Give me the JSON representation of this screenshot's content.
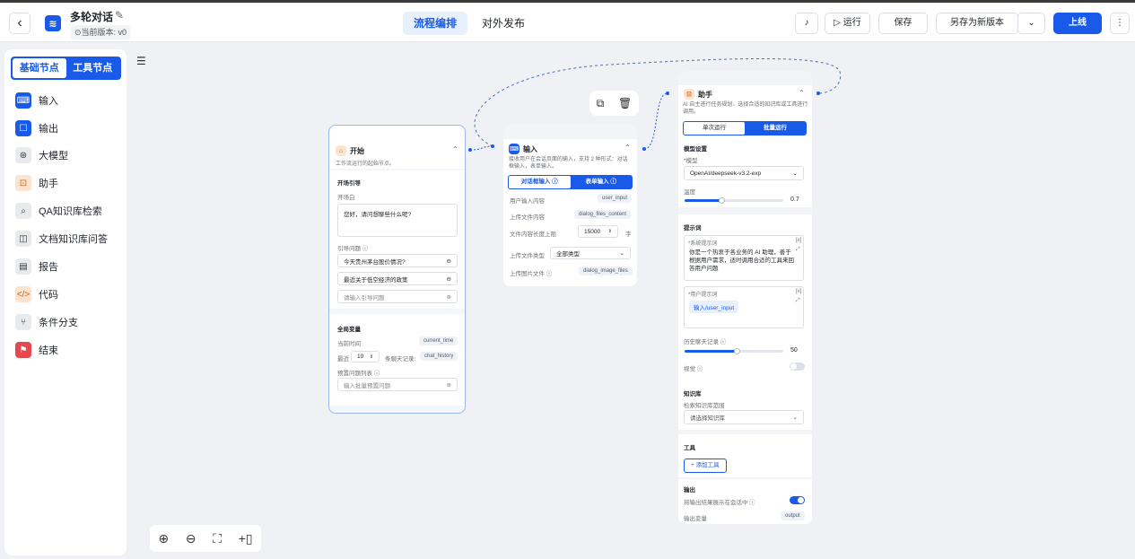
{
  "header": {
    "title": "多轮对话",
    "version": "当前版本: v0",
    "tabs": [
      {
        "label": "流程编排"
      },
      {
        "label": "对外发布"
      }
    ],
    "run_label": "运行",
    "save_label": "保存",
    "save_as_label": "另存为新版本",
    "publish_label": "上线"
  },
  "sidebar": {
    "tab_basic": "基础节点",
    "tab_tools": "工具节点",
    "items": [
      {
        "label": "输入",
        "icon": "keyboard-icon"
      },
      {
        "label": "输出",
        "icon": "chat-icon"
      },
      {
        "label": "大模型",
        "icon": "brain-icon"
      },
      {
        "label": "助手",
        "icon": "robot-icon"
      },
      {
        "label": "QA知识库检索",
        "icon": "search-doc-icon"
      },
      {
        "label": "文档知识库问答",
        "icon": "book-icon"
      },
      {
        "label": "报告",
        "icon": "report-icon"
      },
      {
        "label": "代码",
        "icon": "code-icon"
      },
      {
        "label": "条件分支",
        "icon": "branch-icon"
      },
      {
        "label": "结束",
        "icon": "flag-icon"
      }
    ]
  },
  "start_node": {
    "title": "开始",
    "desc": "工作流运行的起始节点。",
    "section_guide": "开场引导",
    "opening_label": "开场白",
    "opening_text": "您好，请问想聊些什么呢?",
    "questions_label": "引导问题",
    "questions": [
      "今天贵州茅台股价情况?",
      "最近关于低空经济的政策"
    ],
    "question_placeholder": "请输入引导问题",
    "section_vars": "全局变量",
    "current_time_label": "当前时间",
    "current_time_var": "current_time",
    "recent_label": "最近",
    "recent_count": "10",
    "recent_suffix": "条聊天记录:",
    "chat_history_var": "chat_history",
    "preset_label": "预置问题列表",
    "preset_placeholder": "输入批量预置问题"
  },
  "input_node": {
    "title": "输入",
    "desc": "接收用户在会话页面的输入，支持 2 种形式：对话框输入，表单输入。",
    "tab_dialog": "对话框输入",
    "tab_form": "表单输入",
    "rows": [
      {
        "label": "用户输入内容",
        "value": "user_input"
      },
      {
        "label": "上传文件内容",
        "value": "dialog_files_content"
      }
    ],
    "file_limit_label": "文件内容长度上限",
    "file_limit_value": "15000",
    "file_limit_unit": "字",
    "file_type_label": "上传文件类型",
    "file_type_value": "全部类型",
    "image_label": "上传图片文件",
    "image_value": "dialog_image_files"
  },
  "assistant_node": {
    "title": "助手",
    "desc": "AI 自主进行任务规划，选择合适的知识库或工具进行调用。",
    "tab_single": "单次运行",
    "tab_batch": "批量运行",
    "model_section": "模型设置",
    "model_label": "模型",
    "model_value": "OpenAI/deepseek-v3.2-exp",
    "temp_label": "温度",
    "temp_value": "0.7",
    "prompt_section": "提示词",
    "system_label": "系统提示词",
    "system_text": "你是一个热衷于各业务的 AI 助理，善于根据用户需求，适时调用合适的工具来回答用户问题",
    "user_label": "用户提示词",
    "user_text": "输入/user_input",
    "history_label": "历史聊天记录",
    "history_value": "50",
    "vision_label": "视觉",
    "kb_section": "知识库",
    "kb_label": "检索知识库范围",
    "kb_placeholder": "请选择知识库",
    "tools_section": "工具",
    "add_tool": "+ 添加工具",
    "output_section": "输出",
    "output_toggle_label": "将输出结果展示在会话中",
    "output_var_label": "输出变量",
    "output_var": "output"
  },
  "colors": {
    "accent": "#1a5ae8",
    "start_border": "#9bb9ea"
  }
}
